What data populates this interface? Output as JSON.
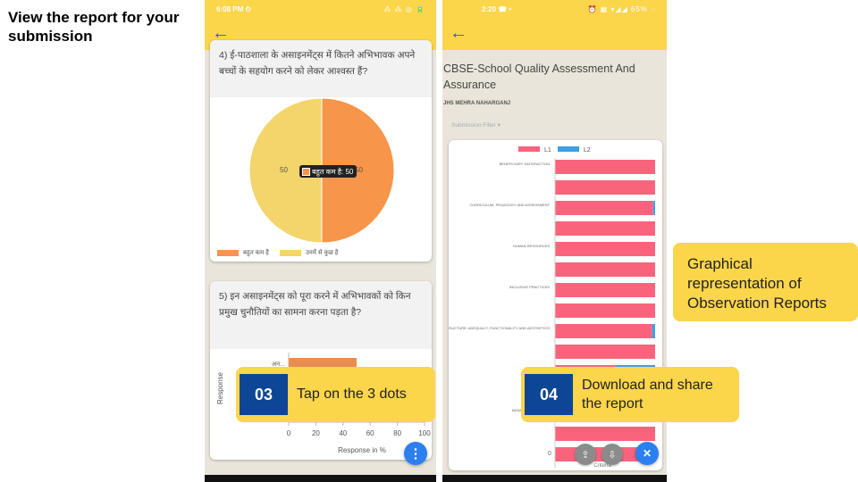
{
  "slide": {
    "title": "View the report for your\nsubmission"
  },
  "phone1": {
    "status": {
      "time": "6:08 PM ⏲",
      "icons": "⁂ ⁂ ◎ 🔋"
    },
    "back_icon": "arrow-left-icon",
    "q4": {
      "text": "4) ई-पाठशाला के असाइनमेंट्स में कितने अभिभावक अपने बच्चों के सहयोग करने को लेकर आश्वस्त हैं?",
      "chart_data": {
        "type": "pie",
        "categories": [
          "बहुत कम है",
          "उनमें से कुछ है"
        ],
        "values": [
          50,
          50
        ],
        "colors": [
          "#f7954a",
          "#f3d56c"
        ],
        "slice_labels": [
          "50",
          "50"
        ],
        "tooltip": "बहुत कम है: 50",
        "legend_position": "bottom"
      }
    },
    "q5": {
      "text": "5) इन असाइनमेंट्स को पूरा करने में अभिभावकों को किन प्रमुख चुनौतियों का सामना करना पड़ता है?",
      "chart_data": {
        "type": "bar",
        "orientation": "horizontal",
        "categories": [
          "अन..."
        ],
        "values": [
          50
        ],
        "color": "#e98c51",
        "xlabel": "Response in %",
        "ylabel": "Response",
        "xlim": [
          0,
          100
        ],
        "xticks": [
          "0",
          "20",
          "40",
          "60",
          "80",
          "100"
        ]
      }
    },
    "fab_icon": "more-vert-icon",
    "fab_glyph": "⋮"
  },
  "phone2": {
    "status": {
      "time": "2:20 ☎ •",
      "icons": "⏰ ▦ ▾◢◢ 65% ◌"
    },
    "back_icon": "arrow-left-icon",
    "title": "CBSE-School Quality Assessment And Assurance",
    "school": "JHS MEHRA NAHARGANJ",
    "filter_label": "Submission Filter ▾",
    "chart_data": {
      "type": "bar",
      "orientation": "horizontal",
      "stacked": true,
      "legend": [
        "L1",
        "L2"
      ],
      "legend_position": "top",
      "colors": [
        "#f9637c",
        "#3f9fe3"
      ],
      "categories": [
        "BENEFICIARY SATISFACTION",
        "",
        "CURRICULUM, PEDAGOGY AND ASSESSMENT",
        "",
        "HUMAN RESOURCES",
        "",
        "INCLUSIVE PRACTICES",
        "",
        "INFRASTRUCTURE: ADEQUACY, FUNCTIONALITY AND AESTHETICS",
        "",
        "",
        "",
        "MANAGEMENT AND ...",
        "",
        ""
      ],
      "series": [
        {
          "name": "L1",
          "values": [
            100,
            100,
            98,
            100,
            100,
            100,
            100,
            100,
            97,
            100,
            60,
            100,
            100,
            100,
            88
          ]
        },
        {
          "name": "L2",
          "values": [
            0,
            0,
            2,
            0,
            0,
            0,
            0,
            0,
            3,
            0,
            40,
            0,
            0,
            0,
            12
          ]
        }
      ],
      "xlabel": "Criteria",
      "xticks": [
        "0"
      ]
    },
    "fab_close_glyph": "✕",
    "fab_share_glyph": "⇪",
    "fab_download_glyph": "⇩"
  },
  "callouts": {
    "step3": {
      "num": "03",
      "text": "Tap on the 3 dots"
    },
    "step4": {
      "num": "04",
      "text": "Download and share\nthe report"
    },
    "graph": {
      "text": "Graphical\nrepresentation of\nObservation Reports"
    }
  }
}
